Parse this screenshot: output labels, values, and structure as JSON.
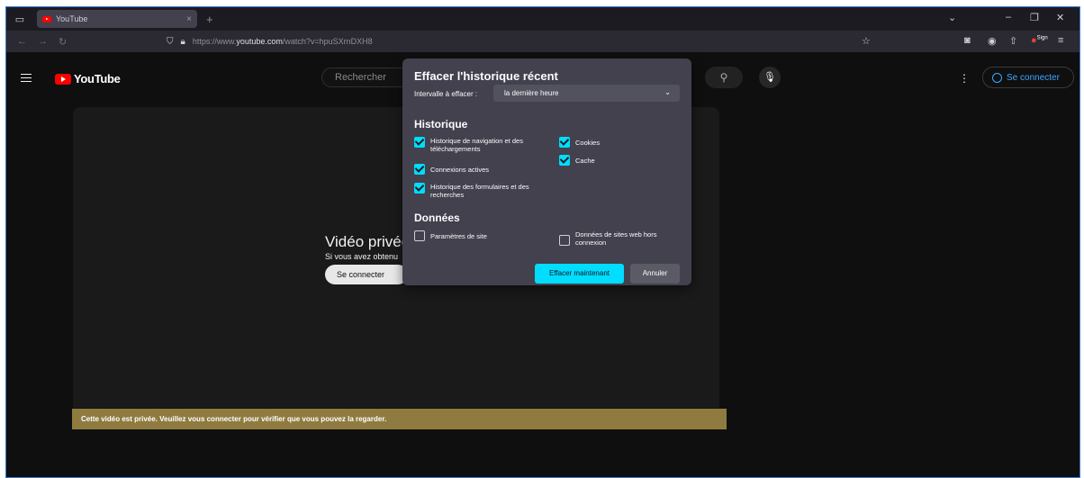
{
  "browser": {
    "tab_title": "YouTube",
    "tab_close": "×",
    "new_tab": "+",
    "url_prefix": "https://www.",
    "url_domain": "youtube.com",
    "url_rest": "/watch?v=hpuSXrnDXH8",
    "addon_badge": "Sign"
  },
  "youtube": {
    "logo_text": "YouTube",
    "search_placeholder": "Rechercher",
    "signin_label": "Se connecter",
    "player": {
      "title": "Vidéo privée",
      "subtitle": "Si vous avez obtenu",
      "button": "Se connecter"
    },
    "banner": "Cette vidéo est privée. Veuillez vous connecter pour vérifier que vous pouvez la regarder."
  },
  "dialog": {
    "title": "Effacer l'historique récent",
    "range_label": "Intervalle à effacer :",
    "range_value": "la dernière heure",
    "history_heading": "Historique",
    "history_items": [
      {
        "label": "Historique de navigation et des téléchargements",
        "checked": true
      },
      {
        "label": "Connexions actives",
        "checked": true
      },
      {
        "label": "Historique des formulaires et des recherches",
        "checked": true
      },
      {
        "label": "Cookies",
        "checked": true
      },
      {
        "label": "Cache",
        "checked": true
      }
    ],
    "data_heading": "Données",
    "data_items": [
      {
        "label": "Paramètres de site",
        "checked": false
      },
      {
        "label": "Données de sites web hors connexion",
        "checked": false
      }
    ],
    "clear_button": "Effacer maintenant",
    "cancel_button": "Annuler"
  },
  "colors": {
    "accent": "#00ddff",
    "dialog_bg": "#42414d",
    "banner": "#8f7b3f",
    "yt_red": "#ff0000"
  }
}
